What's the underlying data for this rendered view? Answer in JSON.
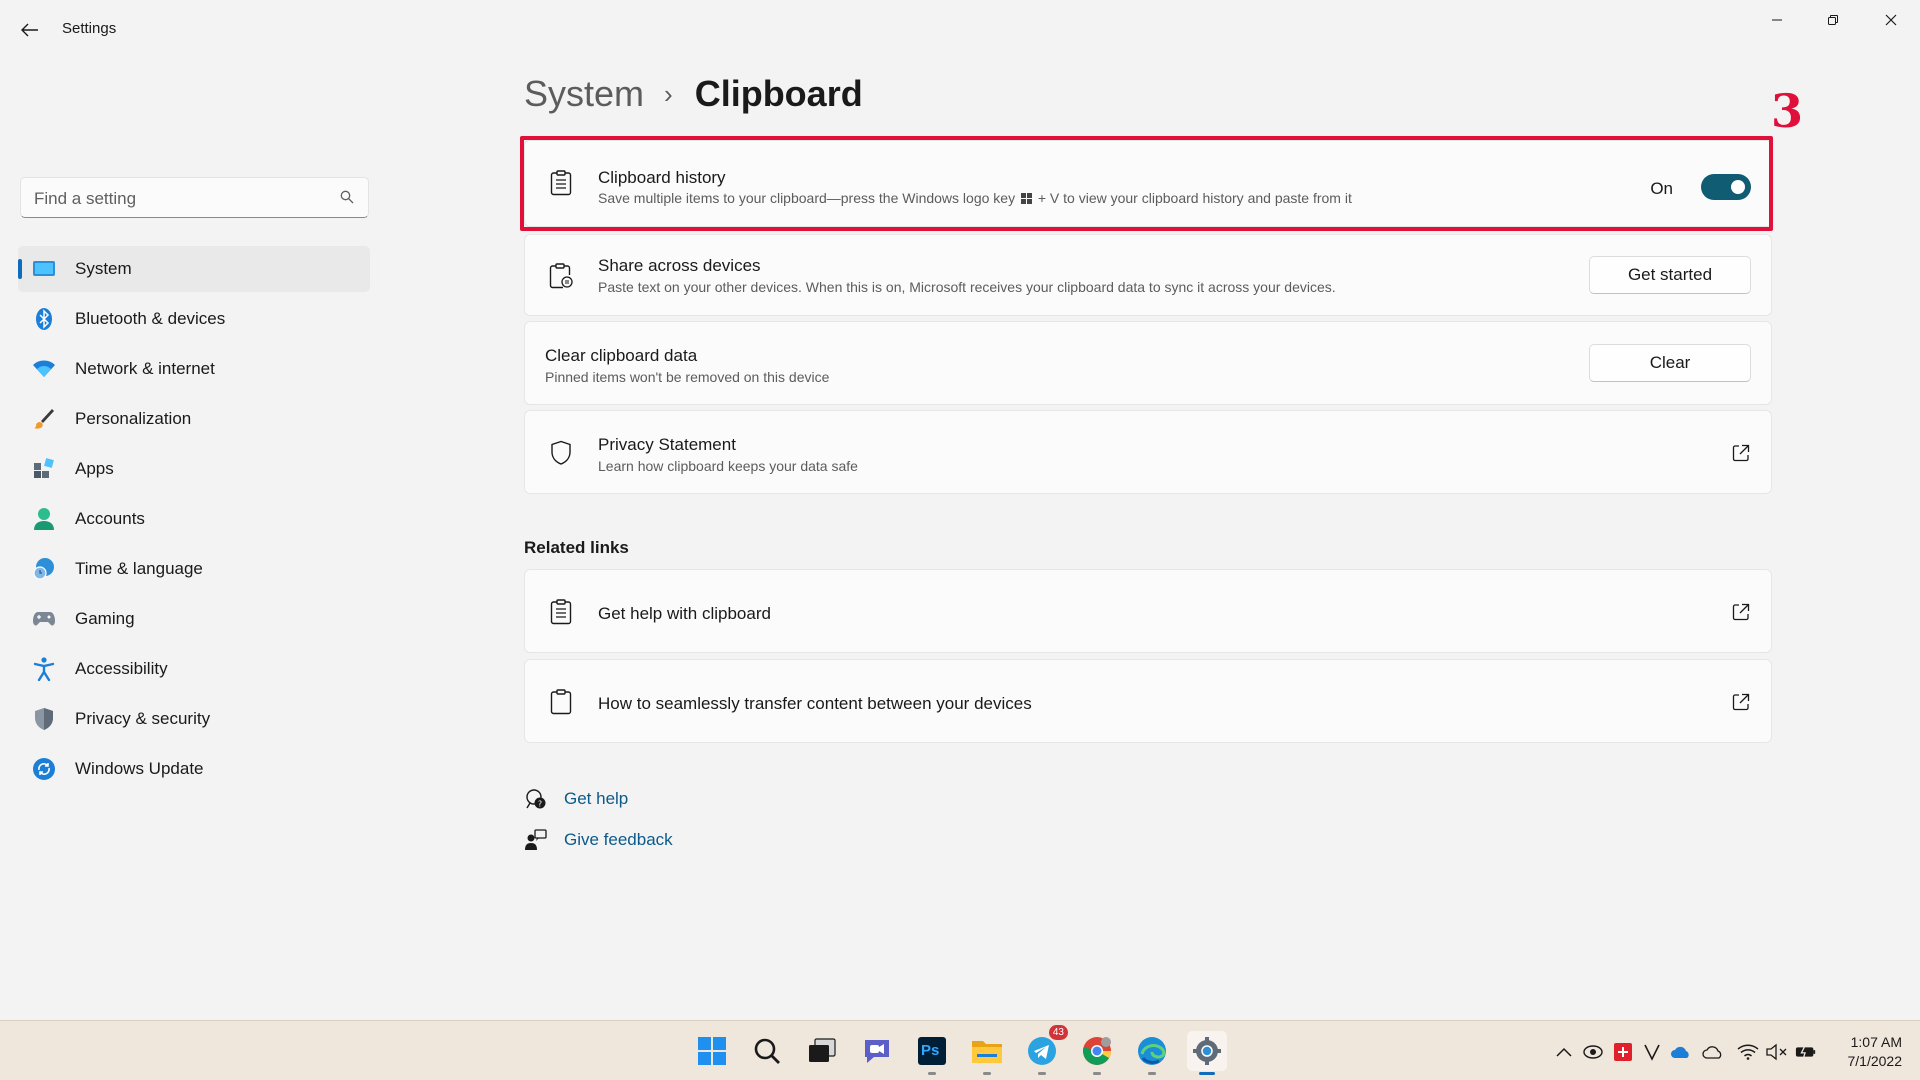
{
  "window": {
    "title": "Settings"
  },
  "search": {
    "placeholder": "Find a setting"
  },
  "sidebar": {
    "items": [
      {
        "label": "System",
        "icon": "system-icon",
        "active": true
      },
      {
        "label": "Bluetooth & devices",
        "icon": "bluetooth-icon"
      },
      {
        "label": "Network & internet",
        "icon": "wifi-icon"
      },
      {
        "label": "Personalization",
        "icon": "brush-icon"
      },
      {
        "label": "Apps",
        "icon": "apps-icon"
      },
      {
        "label": "Accounts",
        "icon": "person-icon"
      },
      {
        "label": "Time & language",
        "icon": "globe-clock-icon"
      },
      {
        "label": "Gaming",
        "icon": "gamepad-icon"
      },
      {
        "label": "Accessibility",
        "icon": "accessibility-icon"
      },
      {
        "label": "Privacy & security",
        "icon": "shield-icon"
      },
      {
        "label": "Windows Update",
        "icon": "update-icon"
      }
    ]
  },
  "breadcrumb": {
    "parent": "System",
    "separator": "›",
    "current": "Clipboard"
  },
  "annotation": {
    "step_number": "3",
    "color": "#e0103a"
  },
  "clipboard_history": {
    "title": "Clipboard history",
    "subtitle_before": "Save multiple items to your clipboard—press the Windows logo key",
    "subtitle_after": "+ V to view your clipboard history and paste from it",
    "toggle_label": "On",
    "toggle_on": true
  },
  "share": {
    "title": "Share across devices",
    "subtitle": "Paste text on your other devices. When this is on, Microsoft receives your clipboard data to sync it across your devices.",
    "button": "Get started"
  },
  "clear": {
    "title": "Clear clipboard data",
    "subtitle": "Pinned items won't be removed on this device",
    "button": "Clear"
  },
  "privacy": {
    "title": "Privacy Statement",
    "subtitle": "Learn how clipboard keeps your data safe"
  },
  "related": {
    "heading": "Related links",
    "links": [
      {
        "label": "Get help with clipboard"
      },
      {
        "label": "How to seamlessly transfer content between your devices"
      }
    ]
  },
  "help": {
    "get_help": "Get help",
    "give_feedback": "Give feedback"
  },
  "taskbar": {
    "apps": [
      "start-icon",
      "search-icon",
      "task-view-icon",
      "chat-icon",
      "photoshop-icon",
      "file-explorer-icon",
      "telegram-icon",
      "chrome-icon",
      "edge-icon",
      "settings-icon"
    ],
    "telegram_badge": "43",
    "photoshop_label": "Ps",
    "accent": "#0f6cbd"
  },
  "clock": {
    "time": "1:07 AM",
    "date": "7/1/2022"
  }
}
